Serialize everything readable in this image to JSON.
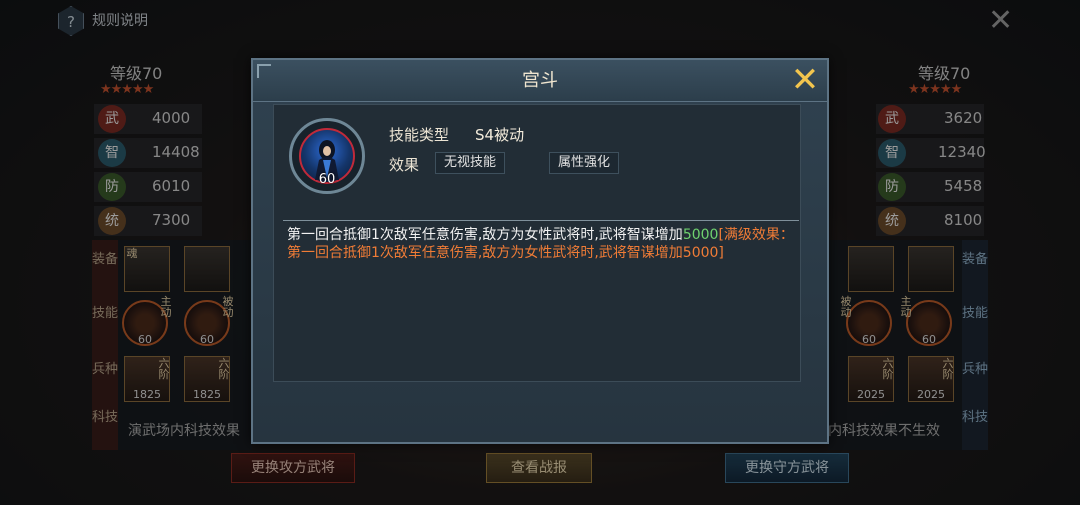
{
  "top_bar": {
    "help_icon_glyph": "?",
    "help_label": "规则说明",
    "close_glyph": "✕"
  },
  "left": {
    "level": "等级70",
    "stars": "★★★★★",
    "stats": [
      {
        "badge": "武",
        "value": "4000",
        "color": "#7a2a22"
      },
      {
        "badge": "智",
        "value": "14408",
        "color": "#2a5a6a"
      },
      {
        "badge": "防",
        "value": "6010",
        "color": "#3a5a2a"
      },
      {
        "badge": "统",
        "value": "7300",
        "color": "#6a4a2a"
      }
    ],
    "labels": {
      "equip": "装备",
      "skill": "技能",
      "troop": "兵种",
      "tech": "科技"
    },
    "equip_tag": "魂",
    "skills": [
      {
        "tag": "主动",
        "level": "60"
      },
      {
        "tag": "被动",
        "level": "60"
      }
    ],
    "troops": [
      {
        "tag": "六阶",
        "value": "1825"
      },
      {
        "tag": "六阶",
        "value": "1825"
      }
    ],
    "tech_text": "演武场内科技效果",
    "button": "更换攻方武将"
  },
  "right": {
    "level": "等级70",
    "stars": "★★★★★",
    "stats": [
      {
        "badge": "武",
        "value": "3620",
        "color": "#7a2a22"
      },
      {
        "badge": "智",
        "value": "12340",
        "color": "#2a5a6a"
      },
      {
        "badge": "防",
        "value": "5458",
        "color": "#3a5a2a"
      },
      {
        "badge": "统",
        "value": "8100",
        "color": "#6a4a2a"
      }
    ],
    "labels": {
      "equip": "装备",
      "skill": "技能",
      "troop": "兵种",
      "tech": "科技"
    },
    "skills": [
      {
        "tag": "被动",
        "level": "60"
      },
      {
        "tag": "主动",
        "level": "60"
      }
    ],
    "troops": [
      {
        "tag": "六阶",
        "value": "2025"
      },
      {
        "tag": "六阶",
        "value": "2025"
      }
    ],
    "tech_text": "内科技效果不生效",
    "button": "更换守方武将"
  },
  "center_button": "查看战报",
  "modal": {
    "title": "宫斗",
    "close_glyph": "✕",
    "skill_level": "60",
    "type_label": "技能类型",
    "type_value": "S4被动",
    "effect_label": "效果",
    "effects": [
      "无视技能",
      "属性强化"
    ],
    "desc_main": "第一回合抵御1次敌军任意伤害,敌方为女性武将时,武将智谋增加",
    "desc_value": "5000",
    "desc_full": "[满级效果：第一回合抵御1次敌军任意伤害,敌方为女性武将时,武将智谋增加5000]"
  }
}
